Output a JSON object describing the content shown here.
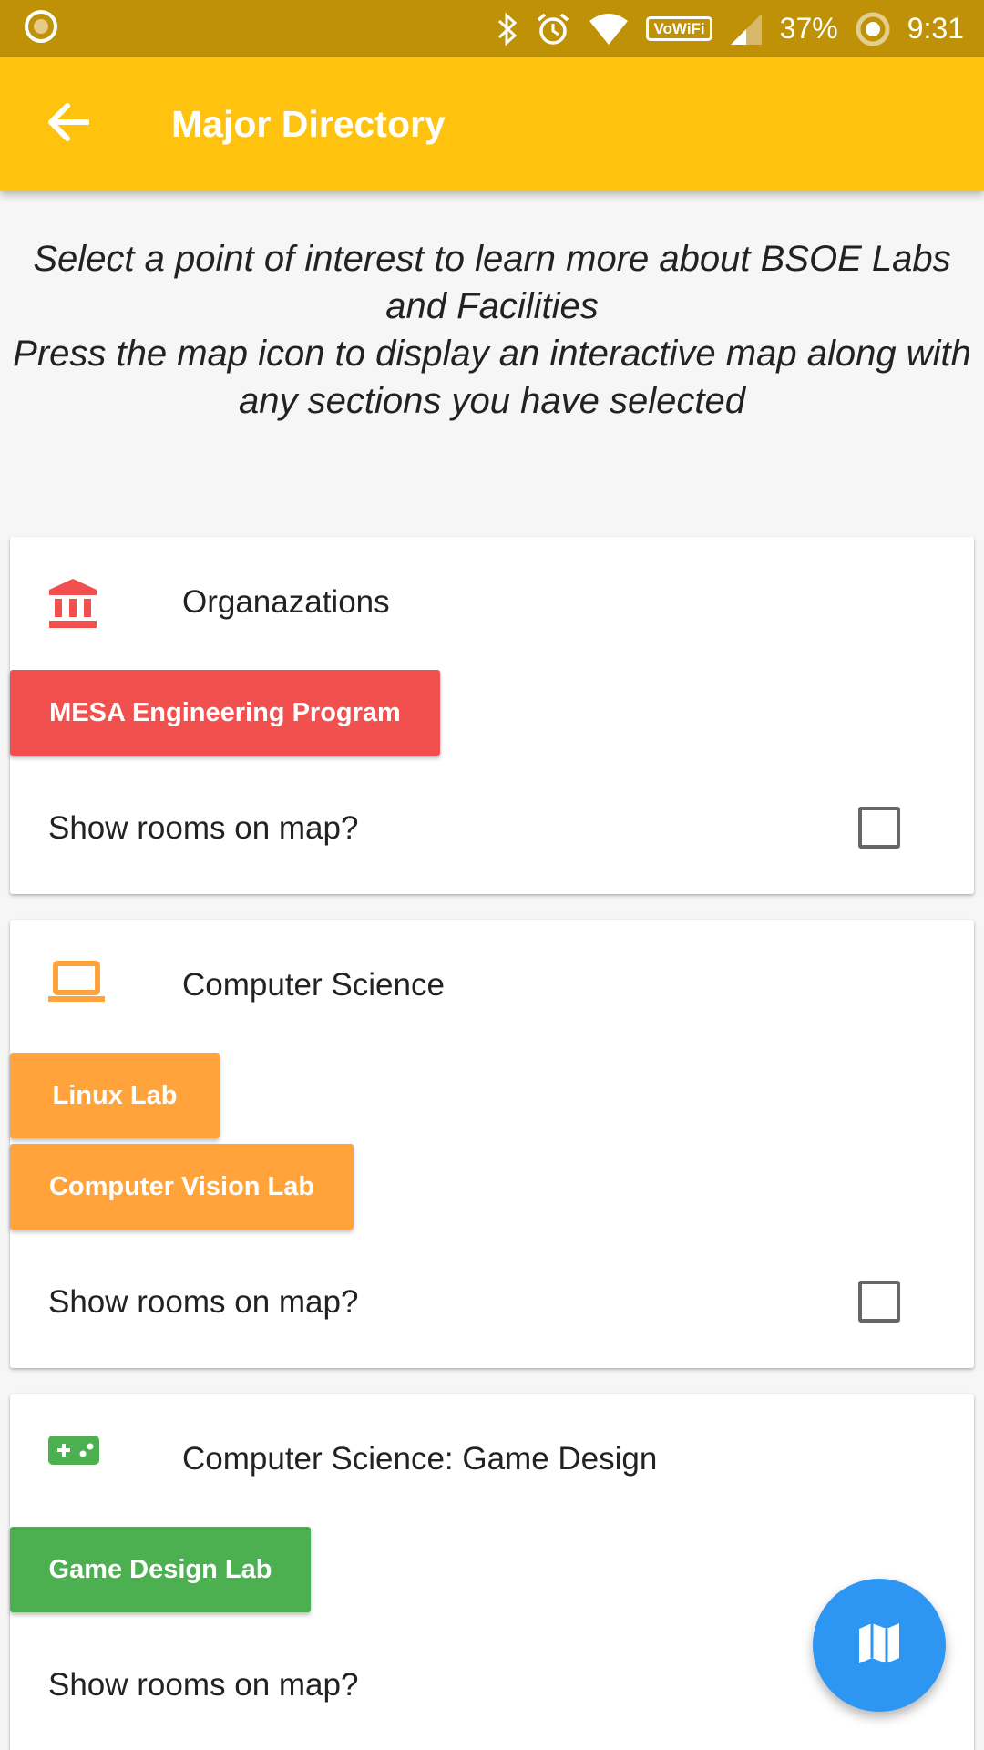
{
  "status_bar": {
    "wifi_badge": "VoWiFi",
    "battery": "37%",
    "time": "9:31",
    "icons": [
      "record-icon",
      "bluetooth-icon",
      "alarm-icon",
      "wifi-icon",
      "cell-signal-icon",
      "data-saver-icon"
    ]
  },
  "app_bar": {
    "title": "Major Directory",
    "back_icon": "arrow-back-icon",
    "color": "#ffc20e"
  },
  "intro": {
    "line1": "Select a point of interest to learn more about BSOE Labs and Facilities",
    "line2": "Press the map icon to display an interactive map along with any sections you have selected"
  },
  "sections": [
    {
      "title": "Organazations",
      "icon": "institution-icon",
      "color": "#f2504f",
      "buttons": [
        "MESA Engineering Program"
      ],
      "show_rooms_label": "Show rooms on map?",
      "checked": false
    },
    {
      "title": "Computer Science",
      "icon": "laptop-icon",
      "color": "#ffa33a",
      "buttons": [
        "Linux Lab",
        "Computer Vision Lab"
      ],
      "show_rooms_label": "Show rooms on map?",
      "checked": false
    },
    {
      "title": "Computer Science: Game Design",
      "icon": "gamepad-icon",
      "color": "#4caf50",
      "buttons": [
        "Game Design Lab"
      ],
      "show_rooms_label": "Show rooms on map?",
      "checked": false
    }
  ],
  "fab": {
    "icon": "map-icon",
    "color": "#2d96f2"
  }
}
